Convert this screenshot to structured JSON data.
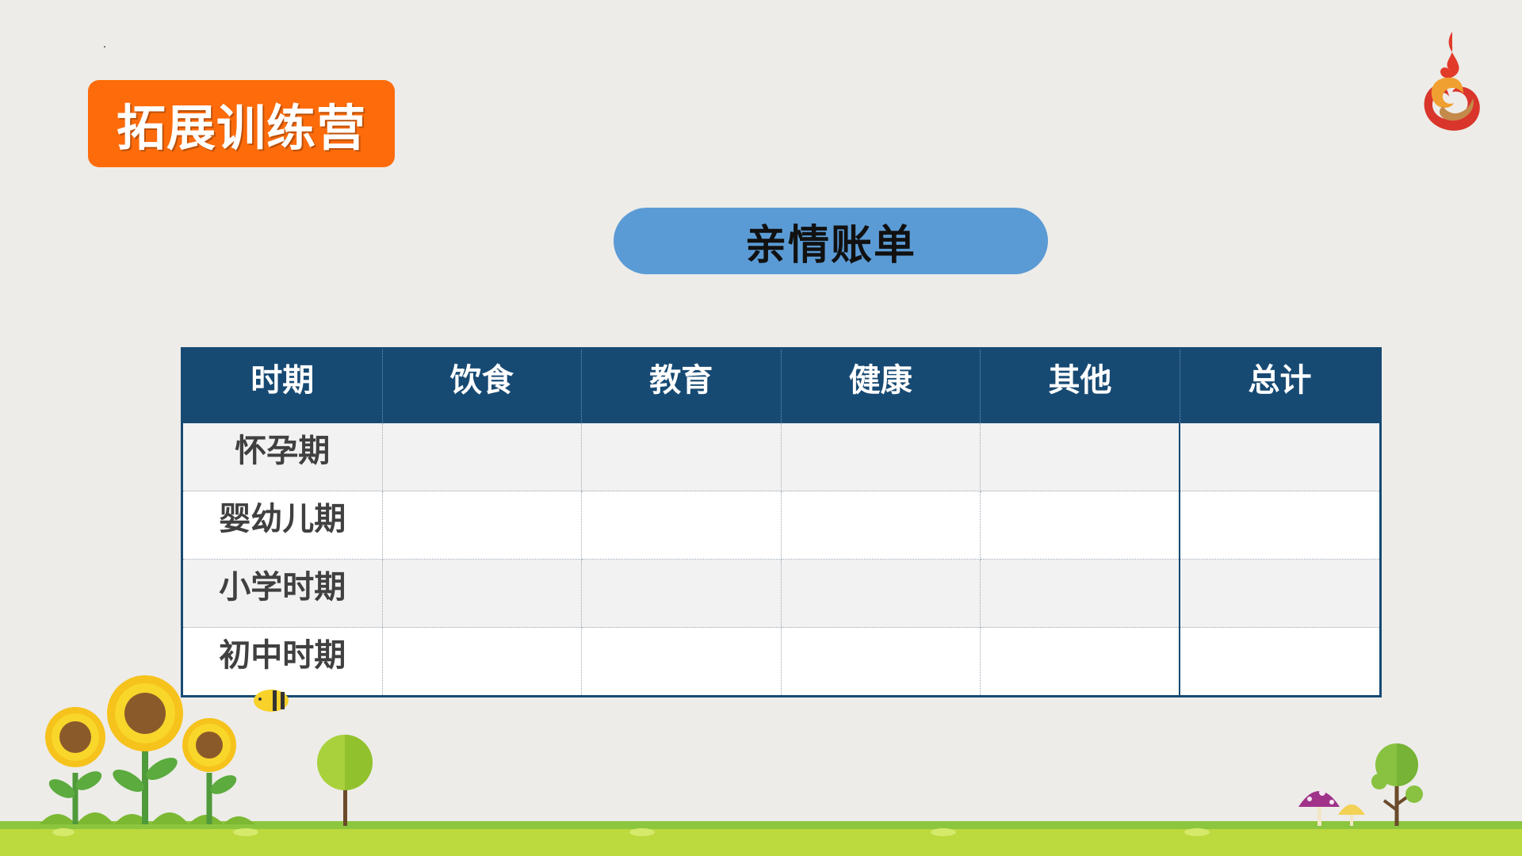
{
  "header": {
    "badge_title": "拓展训练营",
    "section_title": "亲情账单"
  },
  "table": {
    "columns": [
      "时期",
      "饮食",
      "教育",
      "健康",
      "其他",
      "总计"
    ],
    "rows": [
      {
        "period": "怀孕期",
        "cells": [
          "",
          "",
          "",
          "",
          ""
        ]
      },
      {
        "period": "婴幼儿期",
        "cells": [
          "",
          "",
          "",
          "",
          ""
        ]
      },
      {
        "period": "小学时期",
        "cells": [
          "",
          "",
          "",
          "",
          ""
        ]
      },
      {
        "period": "初中时期",
        "cells": [
          "",
          "",
          "",
          "",
          ""
        ]
      }
    ]
  },
  "colors": {
    "background": "#edece8",
    "badge": "#fd6b0a",
    "pill": "#5b9bd5",
    "table_header": "#174a73",
    "grass": "#8cc63f"
  },
  "icons": [
    "swirl-logo-icon",
    "sunflower-icon",
    "bee-icon",
    "tree-icon",
    "mushroom-icon"
  ]
}
